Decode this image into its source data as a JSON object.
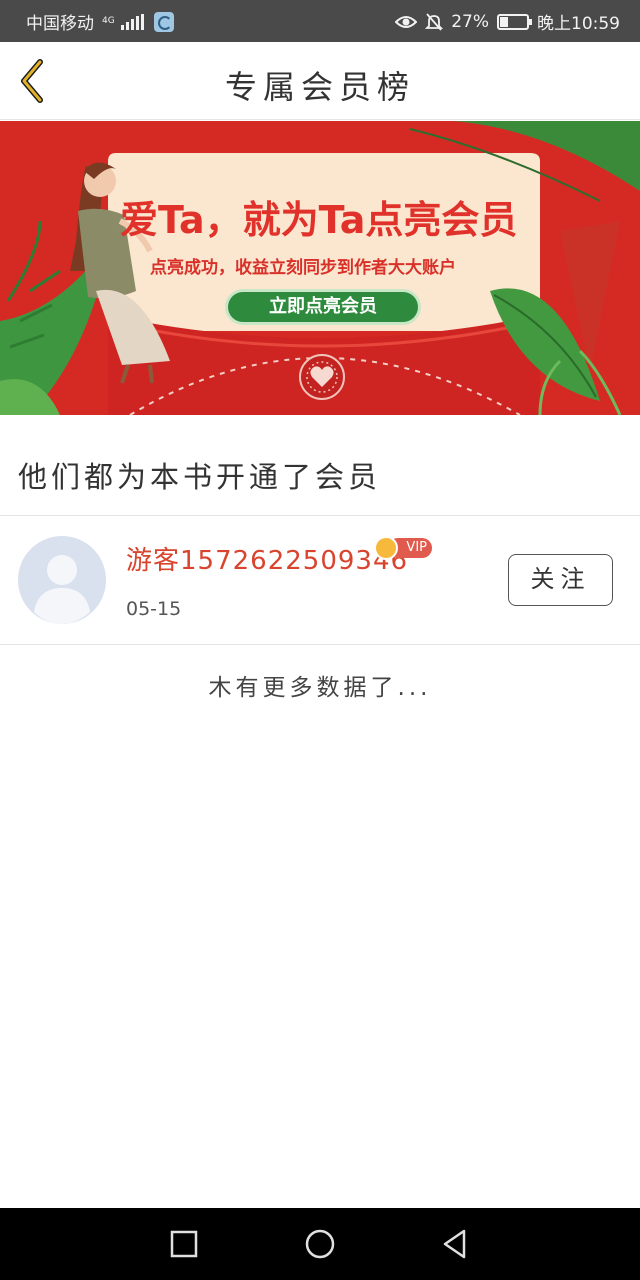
{
  "status_bar": {
    "carrier": "中国移动",
    "network": "4G",
    "battery_percent": "27%",
    "battery_level": 0.27,
    "time": "晚上10:59",
    "icons": [
      "signal-icon",
      "eye-icon",
      "mute-bell-icon",
      "battery-icon"
    ]
  },
  "header": {
    "title": "专属会员榜",
    "back_icon": "chevron-left-icon",
    "accent": "#d9a520"
  },
  "banner": {
    "headline": "爱Ta，就为Ta点亮会员",
    "subline": "点亮成功，收益立刻同步到作者大大账户",
    "button_label": "立即点亮会员",
    "background": "#d52a24"
  },
  "section": {
    "title": "他们都为本书开通了会员"
  },
  "members": [
    {
      "name": "游客1572622509346",
      "badge": "VIP",
      "date": "05-15",
      "follow_label": "关注"
    }
  ],
  "list_footer": "木有更多数据了...",
  "nav": {
    "buttons": [
      "recent-apps-icon",
      "home-icon",
      "back-triangle-icon"
    ]
  }
}
